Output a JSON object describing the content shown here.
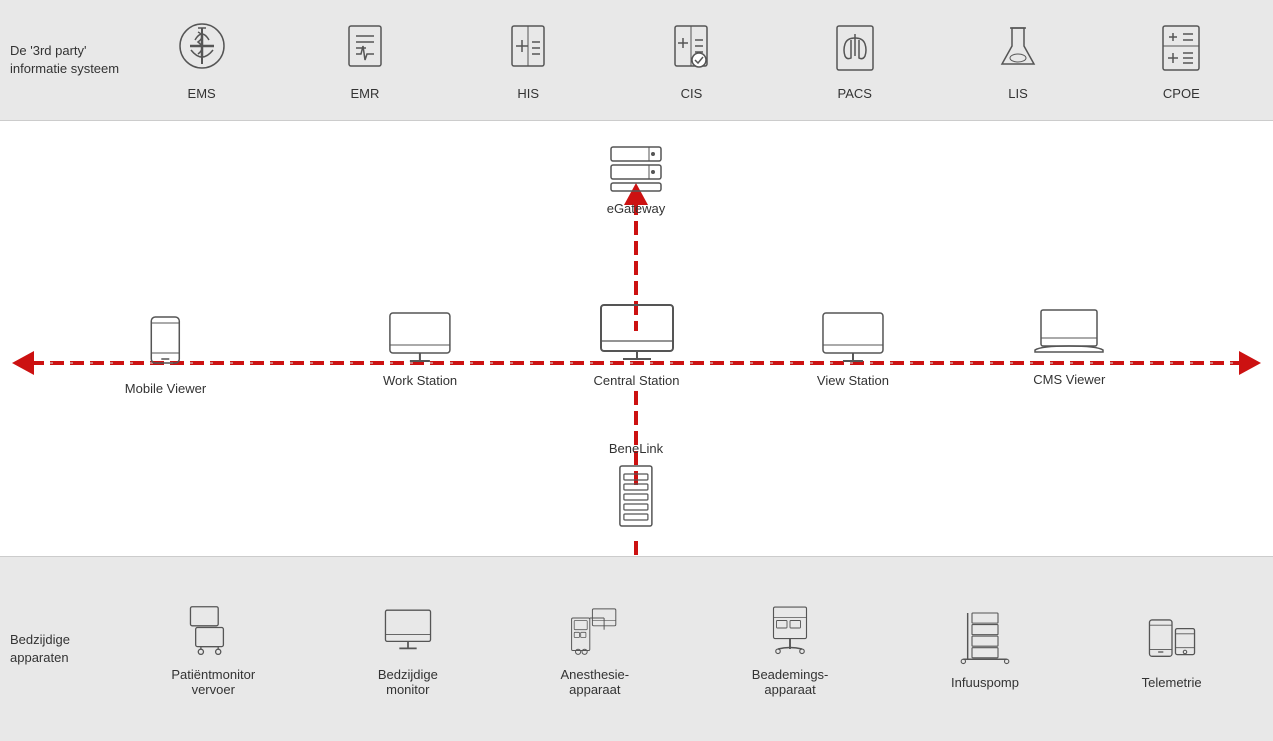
{
  "top": {
    "third_party_label": "De '3rd party' informatie systeem",
    "icons": [
      {
        "id": "ems",
        "label": "EMS"
      },
      {
        "id": "emr",
        "label": "EMR"
      },
      {
        "id": "his",
        "label": "HIS"
      },
      {
        "id": "cis",
        "label": "CIS"
      },
      {
        "id": "pacs",
        "label": "PACS"
      },
      {
        "id": "lis",
        "label": "LIS"
      },
      {
        "id": "cpoe",
        "label": "CPOE"
      }
    ]
  },
  "middle": {
    "egateway_label": "eGateway",
    "stations": [
      {
        "id": "mobile-viewer",
        "label": "Mobile Viewer",
        "pos_pct": 13
      },
      {
        "id": "work-station",
        "label": "Work Station",
        "pos_pct": 33
      },
      {
        "id": "central-station",
        "label": "Central Station",
        "pos_pct": 50
      },
      {
        "id": "view-station",
        "label": "View Station",
        "pos_pct": 67
      },
      {
        "id": "cms-viewer",
        "label": "CMS Viewer",
        "pos_pct": 84
      }
    ],
    "benelink_label": "BeneLink"
  },
  "bottom": {
    "bedside_label": "Bedzijdige apparaten",
    "devices": [
      {
        "id": "patient-monitor",
        "label": "Patiëntmonitor vervoer"
      },
      {
        "id": "bedside-monitor",
        "label": "Bedzijdige monitor"
      },
      {
        "id": "anesthesie",
        "label": "Anesthesie-\napparaat"
      },
      {
        "id": "beademings",
        "label": "Beademings-\napparaat"
      },
      {
        "id": "infuuspomp",
        "label": "Infuuspomp"
      },
      {
        "id": "telemetrie",
        "label": "Telemetrie"
      }
    ]
  },
  "colors": {
    "red": "#cc1111",
    "gray": "#555",
    "light_gray": "#e8e8e8"
  }
}
